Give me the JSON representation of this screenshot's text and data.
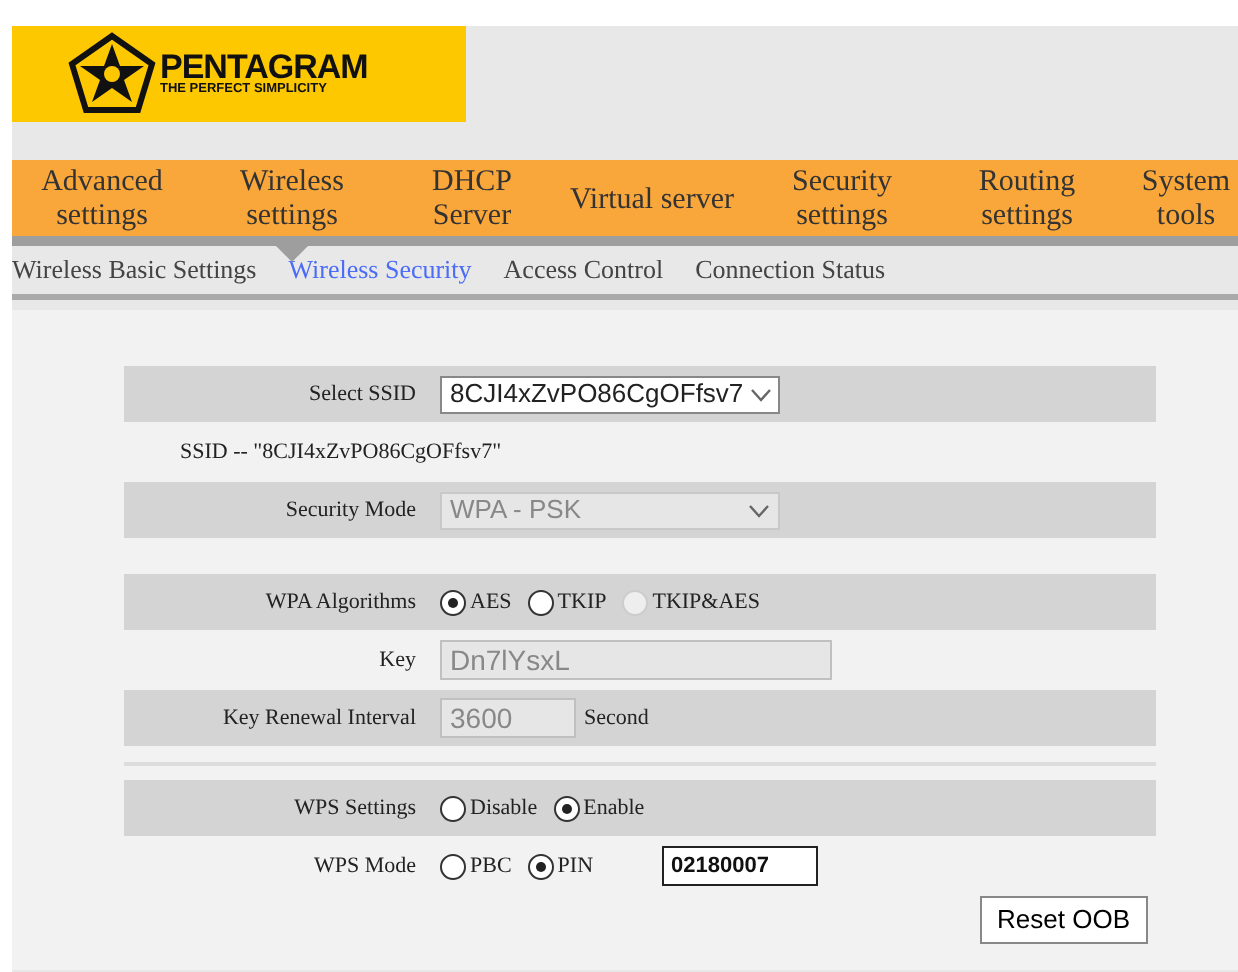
{
  "logo": {
    "name": "PENTAGRAM",
    "tagline": "THE PERFECT SIMPLICITY"
  },
  "nav": [
    {
      "label": "Advanced settings",
      "selected": false
    },
    {
      "label": "Wireless settings",
      "selected": true
    },
    {
      "label": "DHCP Server",
      "selected": false
    },
    {
      "label": "Virtual server",
      "selected": false
    },
    {
      "label": "Security settings",
      "selected": false
    },
    {
      "label": "Routing settings",
      "selected": false
    },
    {
      "label": "System tools",
      "selected": false
    }
  ],
  "subnav": [
    {
      "label": "Wireless Basic Settings",
      "selected": false
    },
    {
      "label": "Wireless Security",
      "selected": true
    },
    {
      "label": "Access Control",
      "selected": false
    },
    {
      "label": "Connection Status",
      "selected": false
    }
  ],
  "form": {
    "rows": [
      {
        "kind": "select",
        "label": "Select SSID",
        "value": "8CJI4xZvPO86CgOFfsv7",
        "disabled": false,
        "shaded": true
      },
      {
        "kind": "note",
        "text": "SSID -- \"8CJI4xZvPO86CgOFfsv7\""
      },
      {
        "kind": "select",
        "label": "Security Mode",
        "value": "WPA - PSK",
        "disabled": true,
        "shaded": true
      },
      {
        "kind": "spacer"
      },
      {
        "kind": "radios",
        "label": "WPA Algorithms",
        "shaded": true,
        "options": [
          {
            "label": "AES",
            "selected": true,
            "disabled": false
          },
          {
            "label": "TKIP",
            "selected": false,
            "disabled": false
          },
          {
            "label": "TKIP&AES",
            "selected": false,
            "disabled": true
          }
        ]
      },
      {
        "kind": "input",
        "label": "Key",
        "value": "Dn7lYsxL",
        "disabled": true,
        "shaded": false
      },
      {
        "kind": "input",
        "label": "Key Renewal Interval",
        "value": "3600",
        "unit": "Second",
        "disabled": true,
        "shaded": true
      },
      {
        "kind": "divider"
      },
      {
        "kind": "radios",
        "label": "WPS Settings",
        "shaded": true,
        "options": [
          {
            "label": "Disable",
            "selected": false,
            "disabled": false
          },
          {
            "label": "Enable",
            "selected": true,
            "disabled": false
          }
        ]
      },
      {
        "kind": "radios",
        "label": "WPS Mode",
        "shaded": false,
        "pin": "02180007",
        "options": [
          {
            "label": "PBC",
            "selected": false,
            "disabled": false
          },
          {
            "label": "PIN",
            "selected": true,
            "disabled": false
          }
        ]
      }
    ],
    "reset_button": "Reset OOB"
  }
}
